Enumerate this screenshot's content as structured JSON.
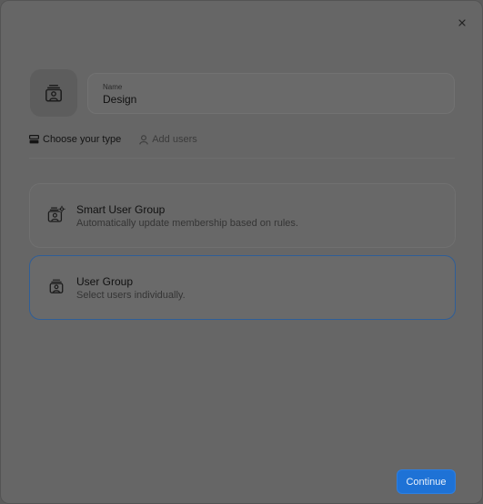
{
  "dialog": {
    "close_icon": "close-icon",
    "name_field": {
      "label": "Name",
      "value": "Design"
    },
    "steps": [
      {
        "label": "Choose your type",
        "icon": "group-type-icon",
        "active": true
      },
      {
        "label": "Add users",
        "icon": "user-icon",
        "active": false
      }
    ],
    "options": [
      {
        "title": "Smart User Group",
        "description": "Automatically update membership based on rules.",
        "icon": "smart-user-group-icon",
        "selected": false
      },
      {
        "title": "User Group",
        "description": "Select users individually.",
        "icon": "user-group-icon",
        "selected": true
      }
    ],
    "continue_label": "Continue"
  },
  "colors": {
    "accent": "#1e72d6",
    "selected_border": "#2f5e97",
    "overlay_bg": "#666666"
  }
}
